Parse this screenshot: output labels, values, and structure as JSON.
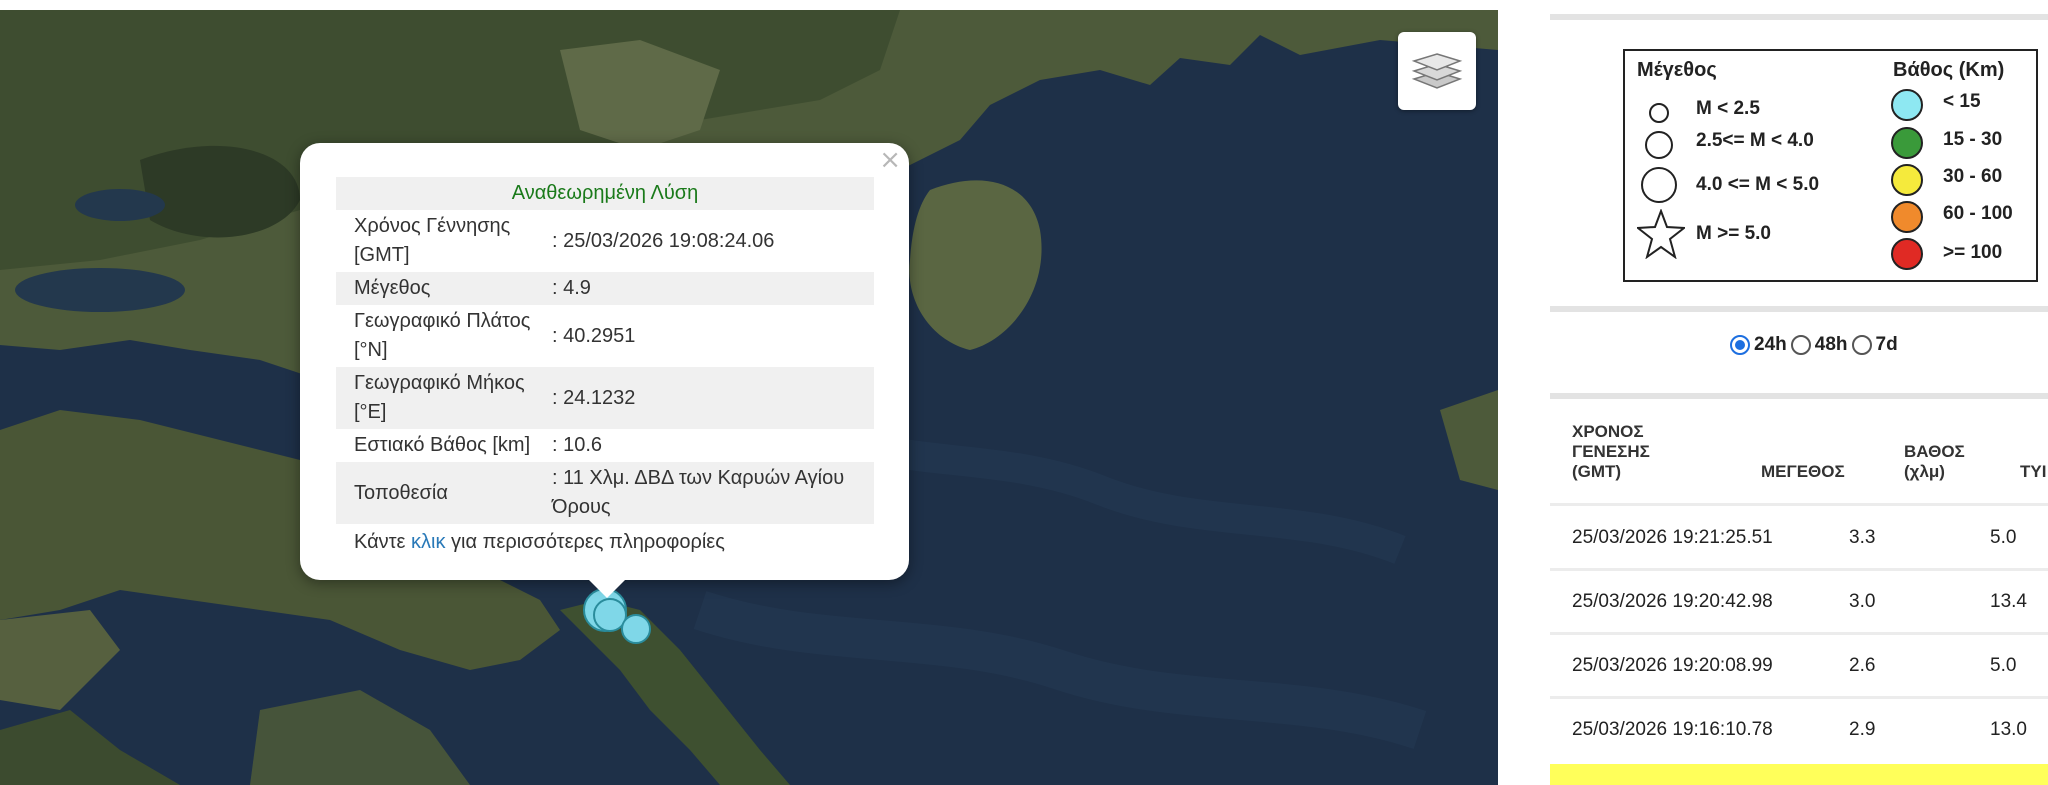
{
  "map": {
    "layers_button_icon": "layers-icon",
    "marker_color": "#7fd7e8"
  },
  "popup": {
    "close_symbol": "×",
    "title": "Αναθεωρημένη Λύση",
    "rows": [
      {
        "label": "Χρόνος Γέννησης [GMT]",
        "value": ": 25/03/2026 19:08:24.06"
      },
      {
        "label": "Μέγεθος",
        "value": ": 4.9"
      },
      {
        "label": "Γεωγραφικό Πλάτος [°N]",
        "value": ": 40.2951"
      },
      {
        "label": "Γεωγραφικό Μήκος [°E]",
        "value": ": 24.1232"
      },
      {
        "label": "Εστιακό Βάθος [km]",
        "value": ": 10.6"
      },
      {
        "label": "Τοποθεσία",
        "value": ": 11 Χλμ. ΔΒΔ των Καρυών Αγίου Όρους"
      }
    ],
    "footer_prefix": "Κάντε ",
    "footer_link": "κλικ",
    "footer_suffix": " για περισσότερες πληροφορίες"
  },
  "legend": {
    "magnitude_title": "Μέγεθος",
    "depth_title": "Βάθος (Km)",
    "magnitude_items": [
      "M < 2.5",
      "2.5<= M < 4.0",
      "4.0 <= M < 5.0",
      "M >= 5.0"
    ],
    "depth_items": [
      {
        "label": "< 15",
        "color": "#8ee8f2"
      },
      {
        "label": "15 - 30",
        "color": "#3a9a3a"
      },
      {
        "label": "30 - 60",
        "color": "#f5ea3c"
      },
      {
        "label": "60 - 100",
        "color": "#f08a2c"
      },
      {
        "label": ">= 100",
        "color": "#e02a24"
      }
    ]
  },
  "filters": {
    "options": [
      "24h",
      "48h",
      "7d"
    ],
    "selected": "24h"
  },
  "table": {
    "headers": {
      "time": [
        "ΧΡΟΝΟΣ",
        "ΓΕΝΕΣΗΣ",
        "(GMT)"
      ],
      "magnitude": "ΜΕΓΕΘΟΣ",
      "depth": [
        "ΒΑΘΟΣ",
        "(χλμ)"
      ],
      "type_partial": "ΤΥΙ"
    },
    "rows": [
      {
        "time": "25/03/2026 19:21:25.51",
        "magnitude": "3.3",
        "depth": "5.0"
      },
      {
        "time": "25/03/2026 19:20:42.98",
        "magnitude": "3.0",
        "depth": "13.4"
      },
      {
        "time": "25/03/2026 19:20:08.99",
        "magnitude": "2.6",
        "depth": "5.0"
      },
      {
        "time": "25/03/2026 19:16:10.78",
        "magnitude": "2.9",
        "depth": "13.0"
      }
    ],
    "highlight_color": "#ffff5a"
  }
}
